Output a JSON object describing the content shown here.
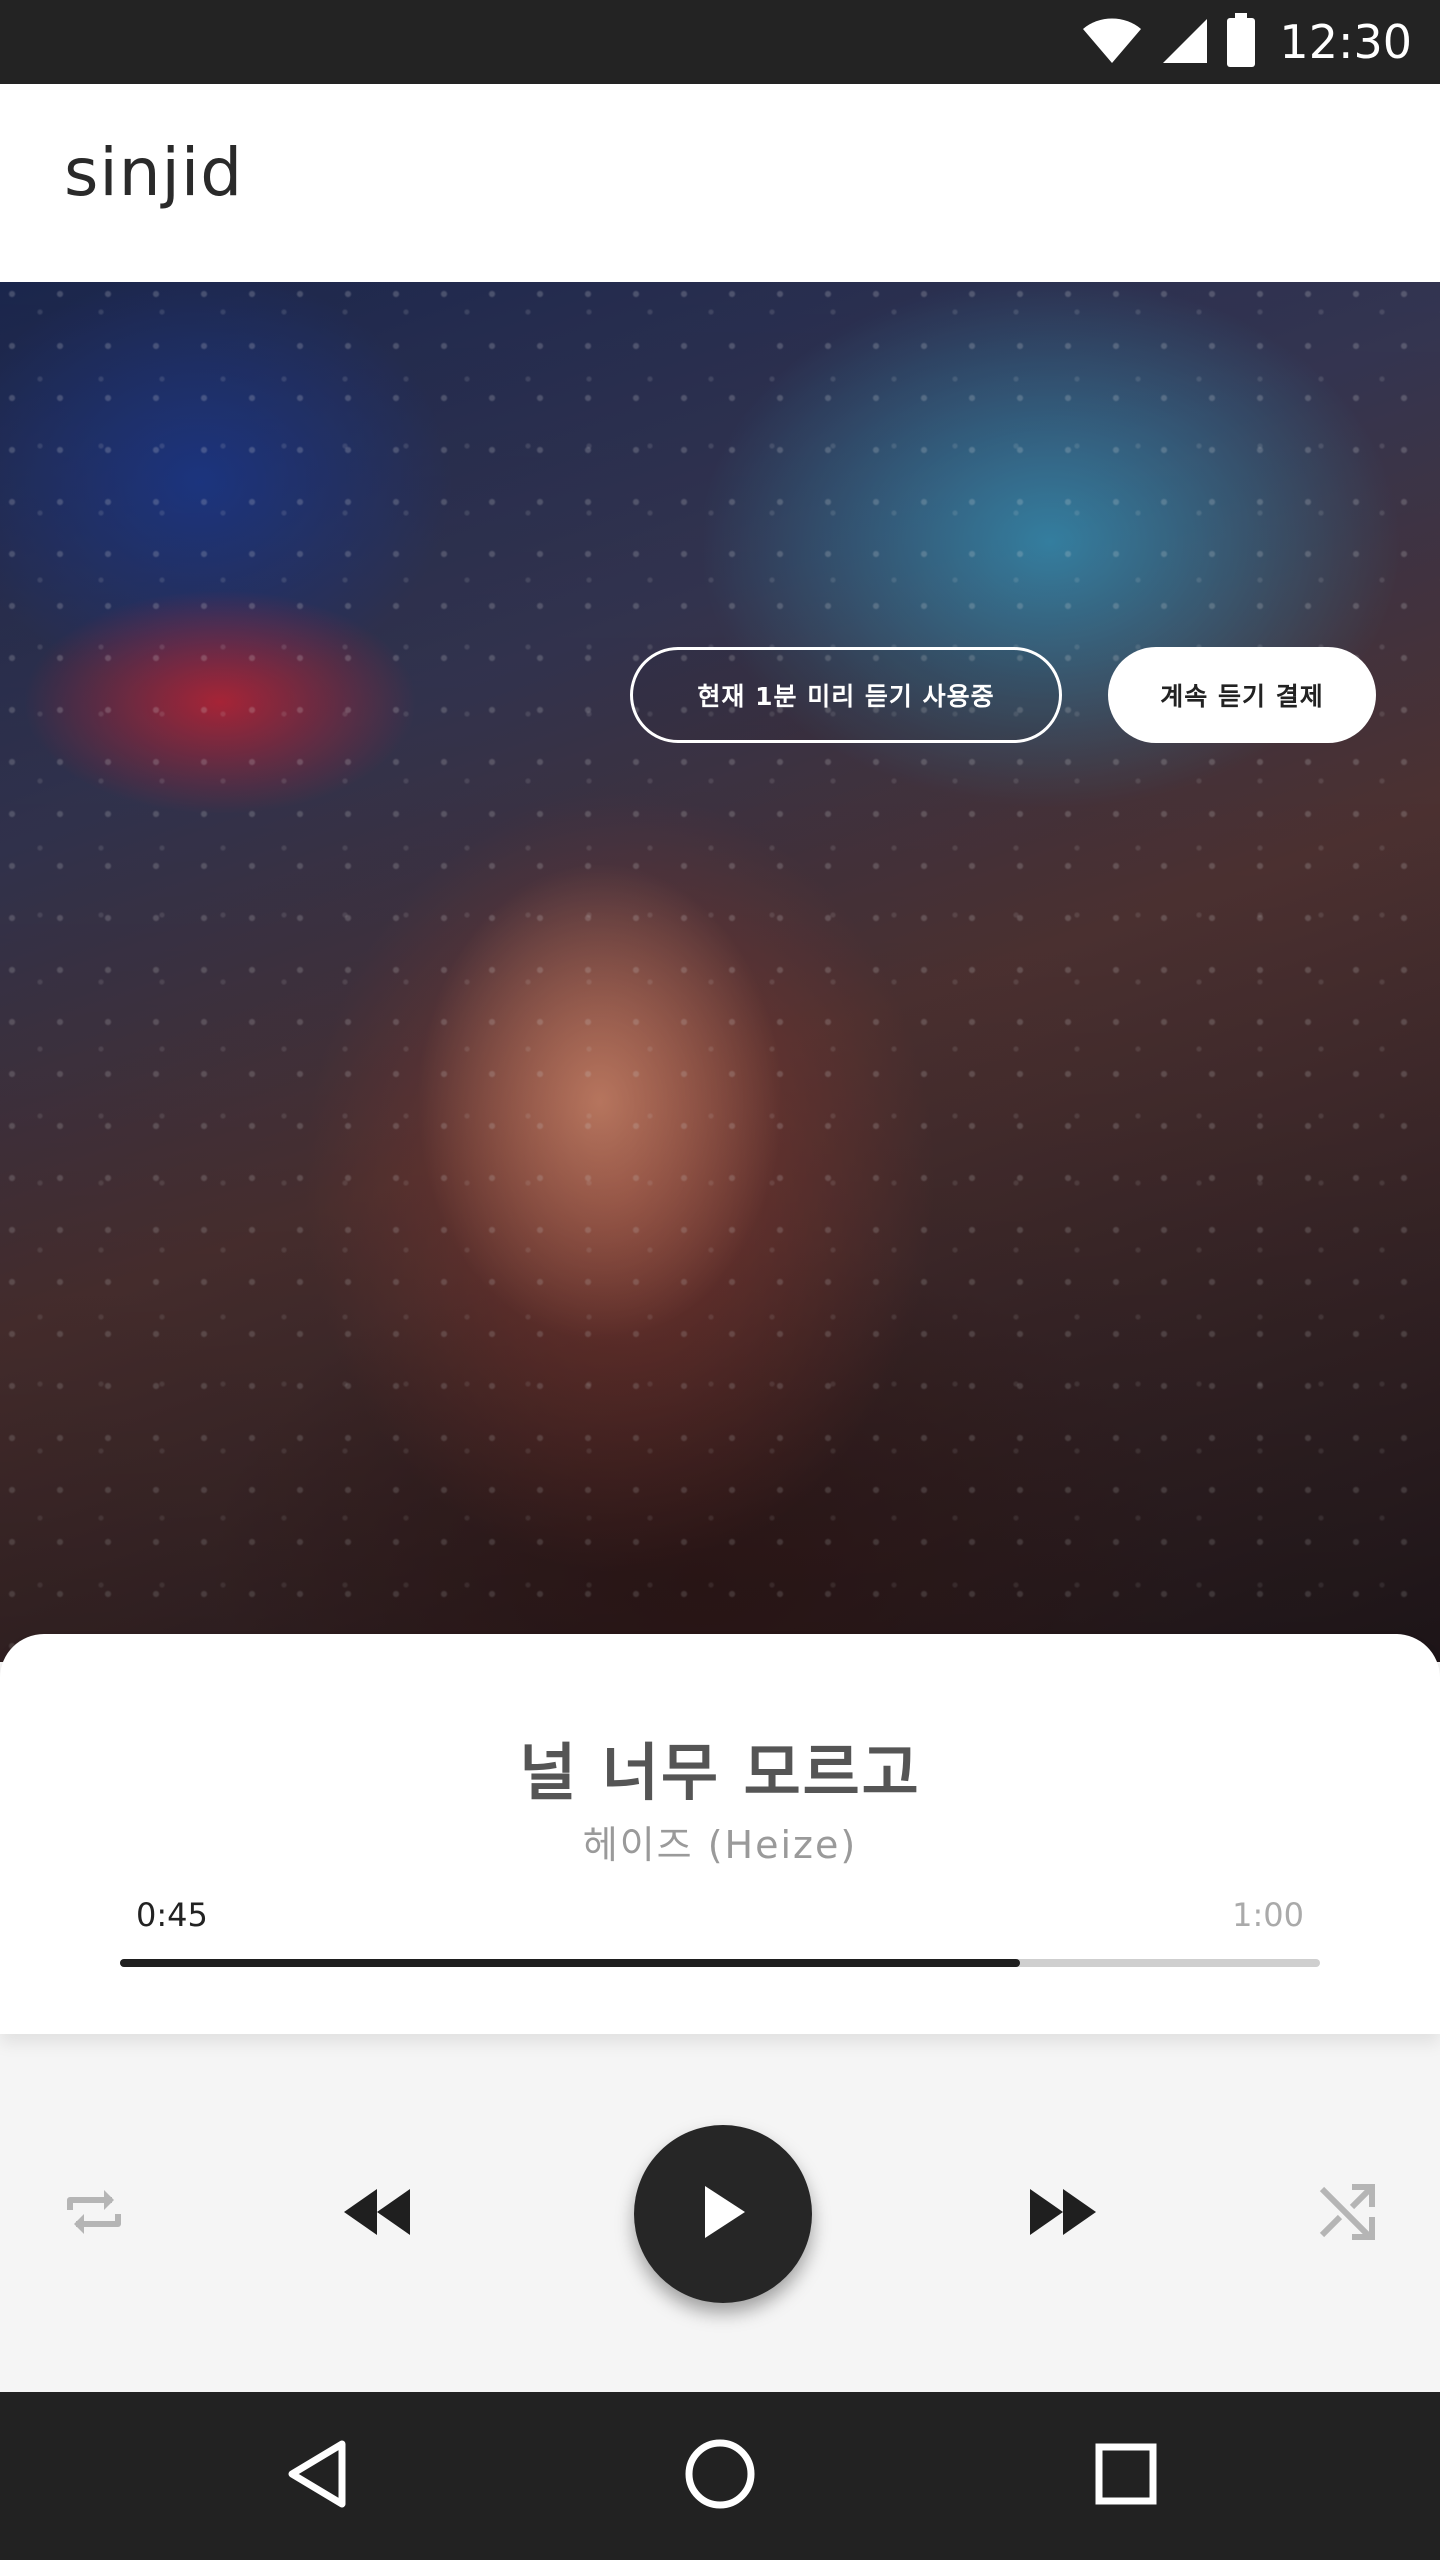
{
  "status_bar": {
    "time": "12:30",
    "icons": [
      "wifi-icon",
      "signal-icon",
      "battery-icon"
    ]
  },
  "header": {
    "brand": "sinjid"
  },
  "album": {
    "preview_badge": "현재 1분 미리 듣기 사용중",
    "purchase_button": "계속 듣기 결제"
  },
  "track": {
    "title": "널 너무 모르고",
    "artist": "헤이즈 (Heize)",
    "elapsed": "0:45",
    "total": "1:00",
    "progress": 0.75
  },
  "controls": {
    "icons": [
      "repeat-icon",
      "rewind-icon",
      "play-icon",
      "fast-forward-icon",
      "shuffle-icon"
    ]
  },
  "nav_bar": {
    "icons": [
      "back-icon",
      "home-icon",
      "recents-icon"
    ]
  },
  "colors": {
    "status_bar": "#232323",
    "nav_bar": "#222222",
    "accent_dark": "#262626",
    "progress_track": "#cfcfcf",
    "muted_icon": "#b5b5b5"
  }
}
